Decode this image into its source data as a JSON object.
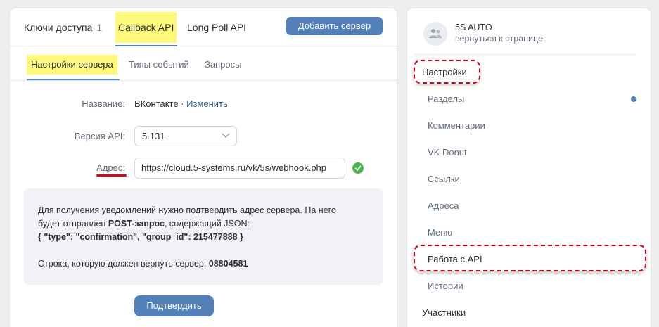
{
  "top_tabs": [
    {
      "label": "Ключи доступа",
      "count": "1"
    },
    {
      "label": "Callback API"
    },
    {
      "label": "Long Poll API"
    }
  ],
  "add_server_label": "Добавить сервер",
  "sub_tabs": [
    "Настройки сервера",
    "Типы событий",
    "Запросы"
  ],
  "form": {
    "name_label": "Название:",
    "name_value": "ВКонтакте",
    "name_sep": " · ",
    "name_edit": "Изменить",
    "api_label": "Версия API:",
    "api_value": "5.131",
    "address_label": "Адрес:",
    "address_value": "https://cloud.5-systems.ru/vk/5s/webhook.php"
  },
  "info": {
    "line1": "Для получения уведомлений нужно подтвердить адрес сервера. На него",
    "line2_pre": "будет отправлен ",
    "line2_bold": "POST-запрос",
    "line2_post": ", содержащий JSON:",
    "json": "{ \"type\": \"confirmation\", \"group_id\": 215477888 }",
    "return_pre": "Строка, которую должен вернуть сервер: ",
    "return_code": "08804581"
  },
  "confirm_label": "Подтвердить",
  "sidebar": {
    "group_name": "5S AUTO",
    "back_link": "вернуться к странице",
    "settings_head": "Настройки",
    "items": [
      "Разделы",
      "Комментарии",
      "VK Donut",
      "Ссылки",
      "Адреса",
      "Меню",
      "Работа с API",
      "Истории"
    ],
    "members_head": "Участники"
  },
  "colors": {
    "accent": "#5181b8",
    "highlight": "#fdf97a",
    "annotation": "#d0021b",
    "success": "#4bb34b"
  }
}
